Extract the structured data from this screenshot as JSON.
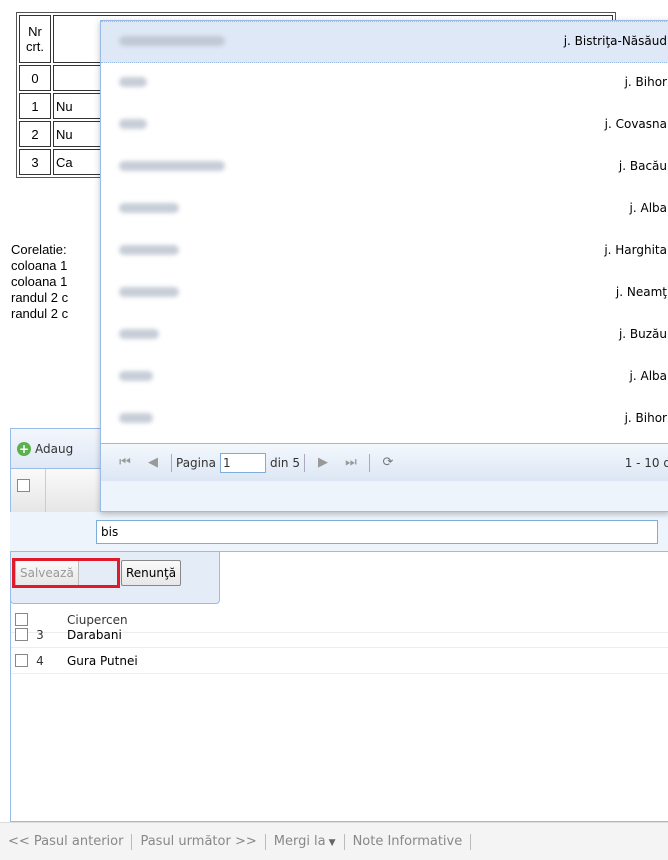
{
  "table": {
    "header": {
      "nr": "Nr crt."
    },
    "rows": [
      {
        "nr": "0",
        "name": ""
      },
      {
        "nr": "1",
        "name": "Nu"
      },
      {
        "nr": "2",
        "name": "Nu"
      },
      {
        "nr": "3",
        "name": "Ca"
      }
    ]
  },
  "corelatie": {
    "lines": [
      "Corelatie:",
      "coloana 1",
      "coloana 1",
      "randul 2 c",
      "randul 2 c"
    ]
  },
  "grid": {
    "add_label": "Adaug",
    "rows": [
      {
        "num": "3",
        "name": "Darabani"
      },
      {
        "num": "4",
        "name": "Gura Putnei"
      }
    ],
    "partial_row_name": "Ciupercen"
  },
  "dropdown": {
    "items": [
      {
        "county": "j. Bistriţa-Năsăud",
        "selected": true
      },
      {
        "county": "j. Bihor"
      },
      {
        "county": "j. Covasna"
      },
      {
        "county": "j. Bacău"
      },
      {
        "county": "j. Alba"
      },
      {
        "county": "j. Harghita"
      },
      {
        "county": "j. Neamţ"
      },
      {
        "county": "j. Buzău"
      },
      {
        "county": "j. Alba"
      },
      {
        "county": "j. Bihor"
      }
    ],
    "pager": {
      "page_label": "Pagina",
      "page_value": "1",
      "of_label": "din 5",
      "display": "1 - 10 d"
    }
  },
  "editor": {
    "input_value": "bis",
    "save_label": "Salvează",
    "cancel_label": "Renunţă"
  },
  "bottom_nav": {
    "prev": "<< Pasul anterior",
    "next": "Pasul următor >>",
    "goto": "Mergi la",
    "notes": "Note Informative"
  },
  "colors": {
    "accent": "#99bbe8",
    "highlight": "#e0192b"
  }
}
